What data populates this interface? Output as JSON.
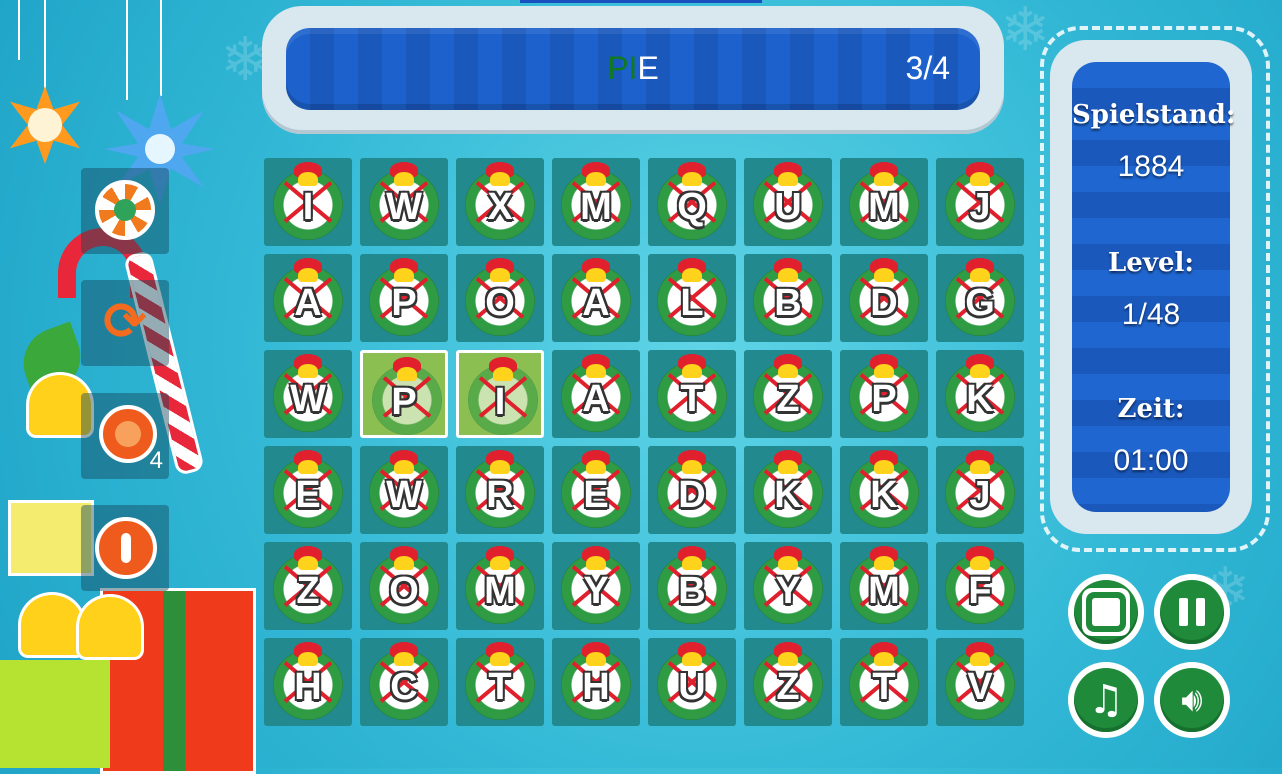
{
  "current_word": {
    "found_part": "PI",
    "remaining_part": "E",
    "found_color": "#0f7a1e",
    "remaining_color": "#ffffff",
    "progress": "3/4"
  },
  "grid": {
    "rows": [
      [
        "I",
        "W",
        "X",
        "M",
        "Q",
        "U",
        "M",
        "J"
      ],
      [
        "A",
        "P",
        "O",
        "A",
        "L",
        "B",
        "D",
        "G"
      ],
      [
        "W",
        "P",
        "I",
        "A",
        "T",
        "Z",
        "P",
        "K"
      ],
      [
        "E",
        "W",
        "R",
        "E",
        "D",
        "K",
        "K",
        "J"
      ],
      [
        "Z",
        "O",
        "M",
        "Y",
        "B",
        "Y",
        "M",
        "F"
      ],
      [
        "H",
        "C",
        "T",
        "H",
        "U",
        "Z",
        "T",
        "V"
      ]
    ],
    "selected": [
      [
        2,
        1
      ],
      [
        2,
        2
      ]
    ]
  },
  "stats": {
    "score_label": "Spielstand:",
    "score_value": "1884",
    "level_label": "Level:",
    "level_value": "1/48",
    "time_label": "Zeit:",
    "time_value": "01:00"
  },
  "powerups": [
    {
      "icon": "lollipop-icon",
      "count": ""
    },
    {
      "icon": "shuffle-icon",
      "count": ""
    },
    {
      "icon": "alarm-clock-icon",
      "count": "4"
    },
    {
      "icon": "stop-icon",
      "count": ""
    }
  ],
  "controls": [
    {
      "icon": "fullscreen-icon"
    },
    {
      "icon": "pause-icon"
    },
    {
      "icon": "music-icon"
    },
    {
      "icon": "sound-icon"
    }
  ]
}
